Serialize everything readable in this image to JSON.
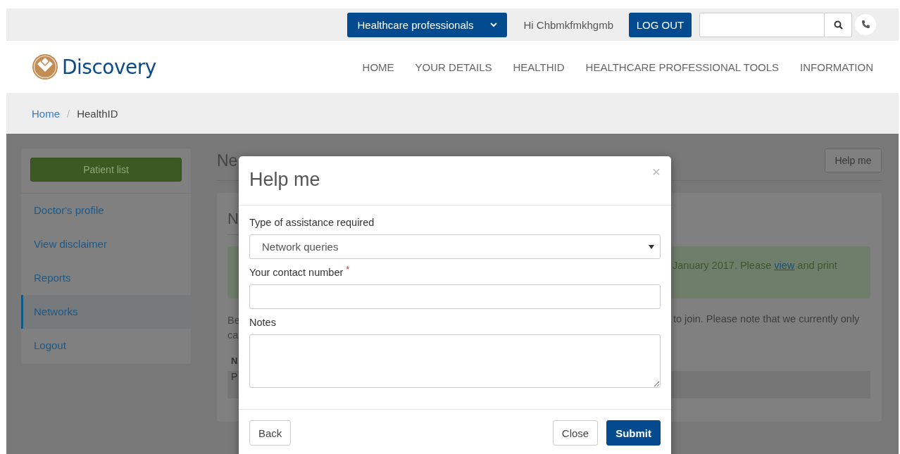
{
  "topbar": {
    "audience_menu": "Healthcare professionals",
    "greeting": "Hi Chbmkfmkhgmb",
    "logout": "LOG OUT"
  },
  "logo": {
    "name": "Discovery"
  },
  "nav": [
    "HOME",
    "YOUR DETAILS",
    "HEALTHID",
    "HEALTHCARE PROFESSIONAL TOOLS",
    "INFORMATION"
  ],
  "breadcrumb": {
    "items": [
      "Home",
      "HealthID"
    ],
    "separator": "/"
  },
  "sidebar": {
    "button": "Patient list",
    "items": [
      {
        "label": "Doctor's profile",
        "selected": false
      },
      {
        "label": "View disclaimer",
        "selected": false
      },
      {
        "label": "Reports",
        "selected": false
      },
      {
        "label": "Networks",
        "selected": true
      },
      {
        "label": "Logout",
        "selected": false
      }
    ]
  },
  "page": {
    "heading": "Ne",
    "help_button": "Help me",
    "card": {
      "heading": "N",
      "alert": {
        "before": "January 2017. Please ",
        "link": "view",
        "after": " and print"
      },
      "paragraph_left": [
        "Be",
        "ca"
      ],
      "paragraph_right": "to join. Please note that we currently only",
      "table_header": "N",
      "table_row": "P"
    }
  },
  "modal": {
    "title": "Help me",
    "close_symbol": "×",
    "fields": [
      {
        "kind": "select",
        "label": "Type of assistance required",
        "value": "Network queries"
      },
      {
        "kind": "input",
        "label": "Your contact number",
        "required_mark": "*"
      },
      {
        "kind": "textarea",
        "label": "Notes"
      }
    ],
    "buttons": {
      "back": "Back",
      "close": "Close",
      "submit": "Submit"
    }
  }
}
